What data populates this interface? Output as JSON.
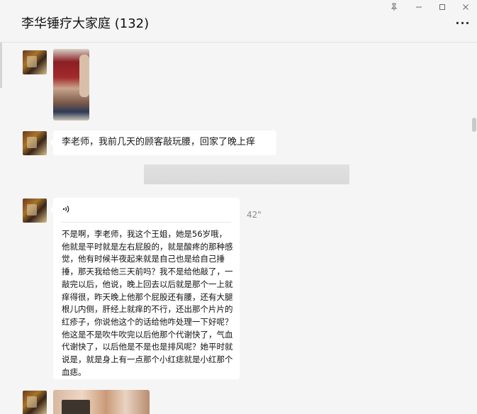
{
  "header": {
    "title": "李华锤疗大家庭 (132)",
    "pin_icon": "pin-icon",
    "minimize_icon": "minimize-icon",
    "maximize_icon": "maximize-icon",
    "close_icon": "close-icon",
    "more_icon": "more-icon"
  },
  "messages": [
    {
      "type": "image",
      "avatar_icon": "avatar",
      "content": "photo"
    },
    {
      "type": "text",
      "avatar_icon": "avatar",
      "text": "李老师，我前几天的顾客敲玩腰，回家了晚上痒"
    },
    {
      "type": "redacted"
    },
    {
      "type": "voice",
      "avatar_icon": "avatar",
      "voice_icon": "voice-wave-icon",
      "duration": "42\"",
      "transcript": "不是啊，李老师，我这个王姐，她是56岁哦，他就是平时就是左右屁股的，就是酸疼的那种感觉，他有时候半夜起来就是自己也是给自己捶捶，那天我给他三天前吗？我不是给他敲了，一敲完以后，他说，晚上回去以后就是那个一上就痒得很，昨天晚上他那个屁股还有腰，还有大腿根儿内侧，肝经上就痒的不行，还出那个片片的红疹子，你说他这个的话给他咋处理一下好呢？他这是不是吹牛吹完以后他那个代谢快了，气血代谢快了，以后他是不是也是排风呢？她平时就说是，就是身上有一点那个小红痣就是小红那个血痣。"
    },
    {
      "type": "image",
      "avatar_icon": "avatar",
      "content": "photo"
    }
  ]
}
